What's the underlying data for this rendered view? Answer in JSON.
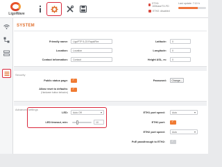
{
  "brand": {
    "name": "LigoWave"
  },
  "header": {
    "tabs": [
      {
        "name": "info",
        "icon": "info-icon"
      },
      {
        "name": "settings",
        "icon": "gear-icon"
      },
      {
        "name": "tools",
        "icon": "tools-icon"
      },
      {
        "name": "storage",
        "icon": "save-icon"
      }
    ],
    "status": [
      {
        "text": "ETH1: 100baseTX-FD"
      },
      {
        "text": "ETH2: disabled"
      }
    ],
    "updates_text": "Last update: 7:10 h",
    "update_progress": 0.7
  },
  "sidebar": {
    "items": [
      {
        "name": "wireless",
        "icon": "wifi-icon"
      },
      {
        "name": "network",
        "icon": "network-icon"
      },
      {
        "name": "services",
        "icon": "services-icon"
      },
      {
        "name": "system",
        "icon": "system-icon",
        "active": true
      }
    ]
  },
  "page": {
    "title": "SYSTEM",
    "friendly_name_label": "Friendly name:",
    "friendly_name_value": "LigoPTP 5-23 RapidFire",
    "location_label": "Location:",
    "location_value": "Location",
    "contact_label": "Contact information:",
    "contact_value": "Contact",
    "latitude_label": "Latitude:",
    "latitude_value": "0",
    "longitude_label": "Longitude:",
    "longitude_value": "0",
    "height_label": "Height ASL, m:",
    "height_value": "0",
    "security_header": "Security",
    "public_status_label": "Public status page:",
    "allow_reset_label": "Allow reset to defaults:",
    "allow_reset_sub": "(Hardware button behavior)",
    "password_label": "Password:",
    "change_button": "Change...",
    "advanced_header": "Advanced settings",
    "led_label": "LED:",
    "led_value": "Auto Off",
    "led_timeout_label": "LED timeout, min:",
    "led_timeout_value": "10",
    "eth1_speed_label": "ETH1 port speed:",
    "eth1_speed_value": "Auto",
    "eth2_label": "ETH2 port:",
    "eth2_speed_label": "ETH2 port speed:",
    "eth2_speed_value": "Auto",
    "poe_label": "PoE passthrough to ETH2:"
  }
}
